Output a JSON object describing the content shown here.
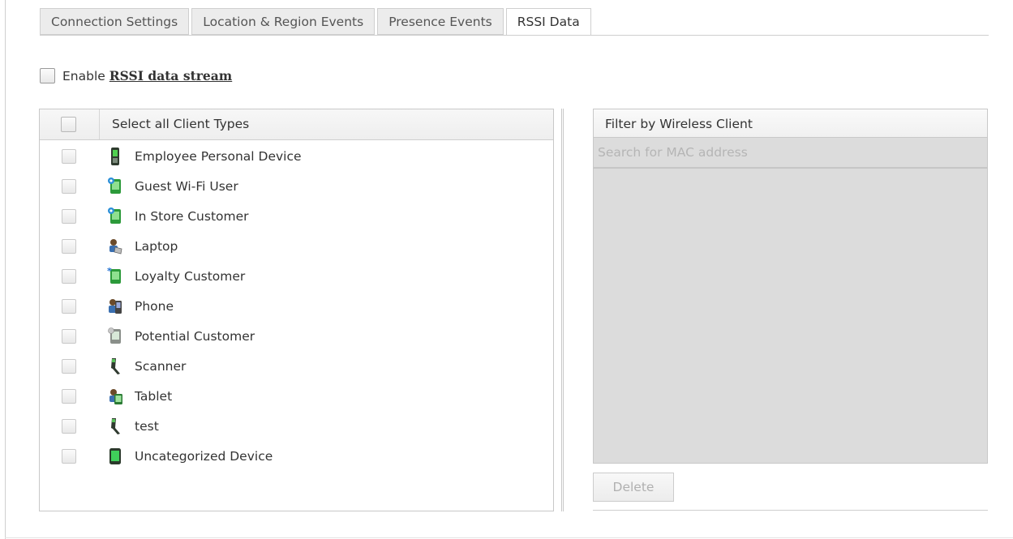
{
  "tabs": [
    {
      "label": "Connection Settings",
      "active": false
    },
    {
      "label": "Location & Region Events",
      "active": false
    },
    {
      "label": "Presence Events",
      "active": false
    },
    {
      "label": "RSSI Data",
      "active": true
    }
  ],
  "enable": {
    "prefix": "Enable",
    "link_label": "RSSI data stream",
    "checked": false
  },
  "client_types": {
    "select_all_label": "Select all Client Types",
    "items": [
      {
        "label": "Employee Personal Device",
        "icon": "mobile-device-icon",
        "checked": false
      },
      {
        "label": "Guest Wi-Fi User",
        "icon": "guest-user-icon",
        "checked": false
      },
      {
        "label": "In Store Customer",
        "icon": "in-store-customer-icon",
        "checked": false
      },
      {
        "label": "Laptop",
        "icon": "laptop-icon",
        "checked": false
      },
      {
        "label": "Loyalty Customer",
        "icon": "loyalty-customer-icon",
        "checked": false
      },
      {
        "label": "Phone",
        "icon": "phone-icon",
        "checked": false
      },
      {
        "label": "Potential Customer",
        "icon": "potential-customer-icon",
        "checked": false
      },
      {
        "label": "Scanner",
        "icon": "scanner-icon",
        "checked": false
      },
      {
        "label": "Tablet",
        "icon": "tablet-icon",
        "checked": false
      },
      {
        "label": "test",
        "icon": "scanner-icon",
        "checked": false
      },
      {
        "label": "Uncategorized Device",
        "icon": "uncategorized-device-icon",
        "checked": false
      }
    ]
  },
  "filter": {
    "header": "Filter by Wireless Client",
    "search_placeholder": "Search for MAC address",
    "search_value": "",
    "delete_label": "Delete"
  },
  "colors": {
    "tab_inactive_bg": "#ececec",
    "panel_disabled_bg": "#dcdcdc",
    "border": "#c8c8c8"
  }
}
